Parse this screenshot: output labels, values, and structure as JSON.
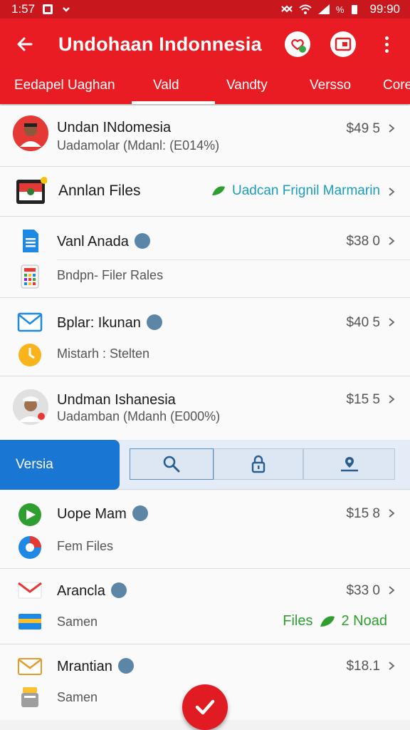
{
  "status_bar": {
    "time": "1:57",
    "right_time": "99:90",
    "battery_label": "%"
  },
  "app_bar": {
    "title": "Undohaan Indonnesia"
  },
  "tabs": [
    {
      "label": "Eedapel Uaghan"
    },
    {
      "label": "Vald",
      "active": true
    },
    {
      "label": "Vandty"
    },
    {
      "label": "Versso"
    },
    {
      "label": "Core"
    }
  ],
  "rows": [
    {
      "title": "Undan INdomesia",
      "subtitle": "Uadamolar (Mdanl: (E014%)",
      "price": "$49 5"
    },
    {
      "title": "Annlan Files",
      "link": "Uadcan Frignil Marmarin"
    },
    {
      "title": "Vanl Anada",
      "subtitle": "Bndpn- Filer Rales",
      "price": "$38 0"
    },
    {
      "title": "Bplar: Ikunan",
      "subtitle": "Mistarh : Stelten",
      "price": "$40 5"
    },
    {
      "title": "Undman Ishanesia",
      "subtitle": "Uadamban (Mdanh (E000%)",
      "price": "$15 5"
    },
    {
      "title": "Uope Mam",
      "subtitle": "Fem Files",
      "price": "$15 8"
    },
    {
      "title": "Arancla",
      "subtitle": "Samen",
      "price": "$33 0",
      "status_left": "Files",
      "status_right": "2 Noad"
    },
    {
      "title": "Mrantian",
      "subtitle": "Samen",
      "price": "$18.1"
    }
  ],
  "sub_nav": {
    "active_label": "Versia"
  },
  "colors": {
    "brand_red": "#e91c24",
    "status_red": "#c8171d",
    "accent_blue": "#1976d2",
    "link_teal": "#1a9dba",
    "status_green": "#2e9e2e"
  }
}
